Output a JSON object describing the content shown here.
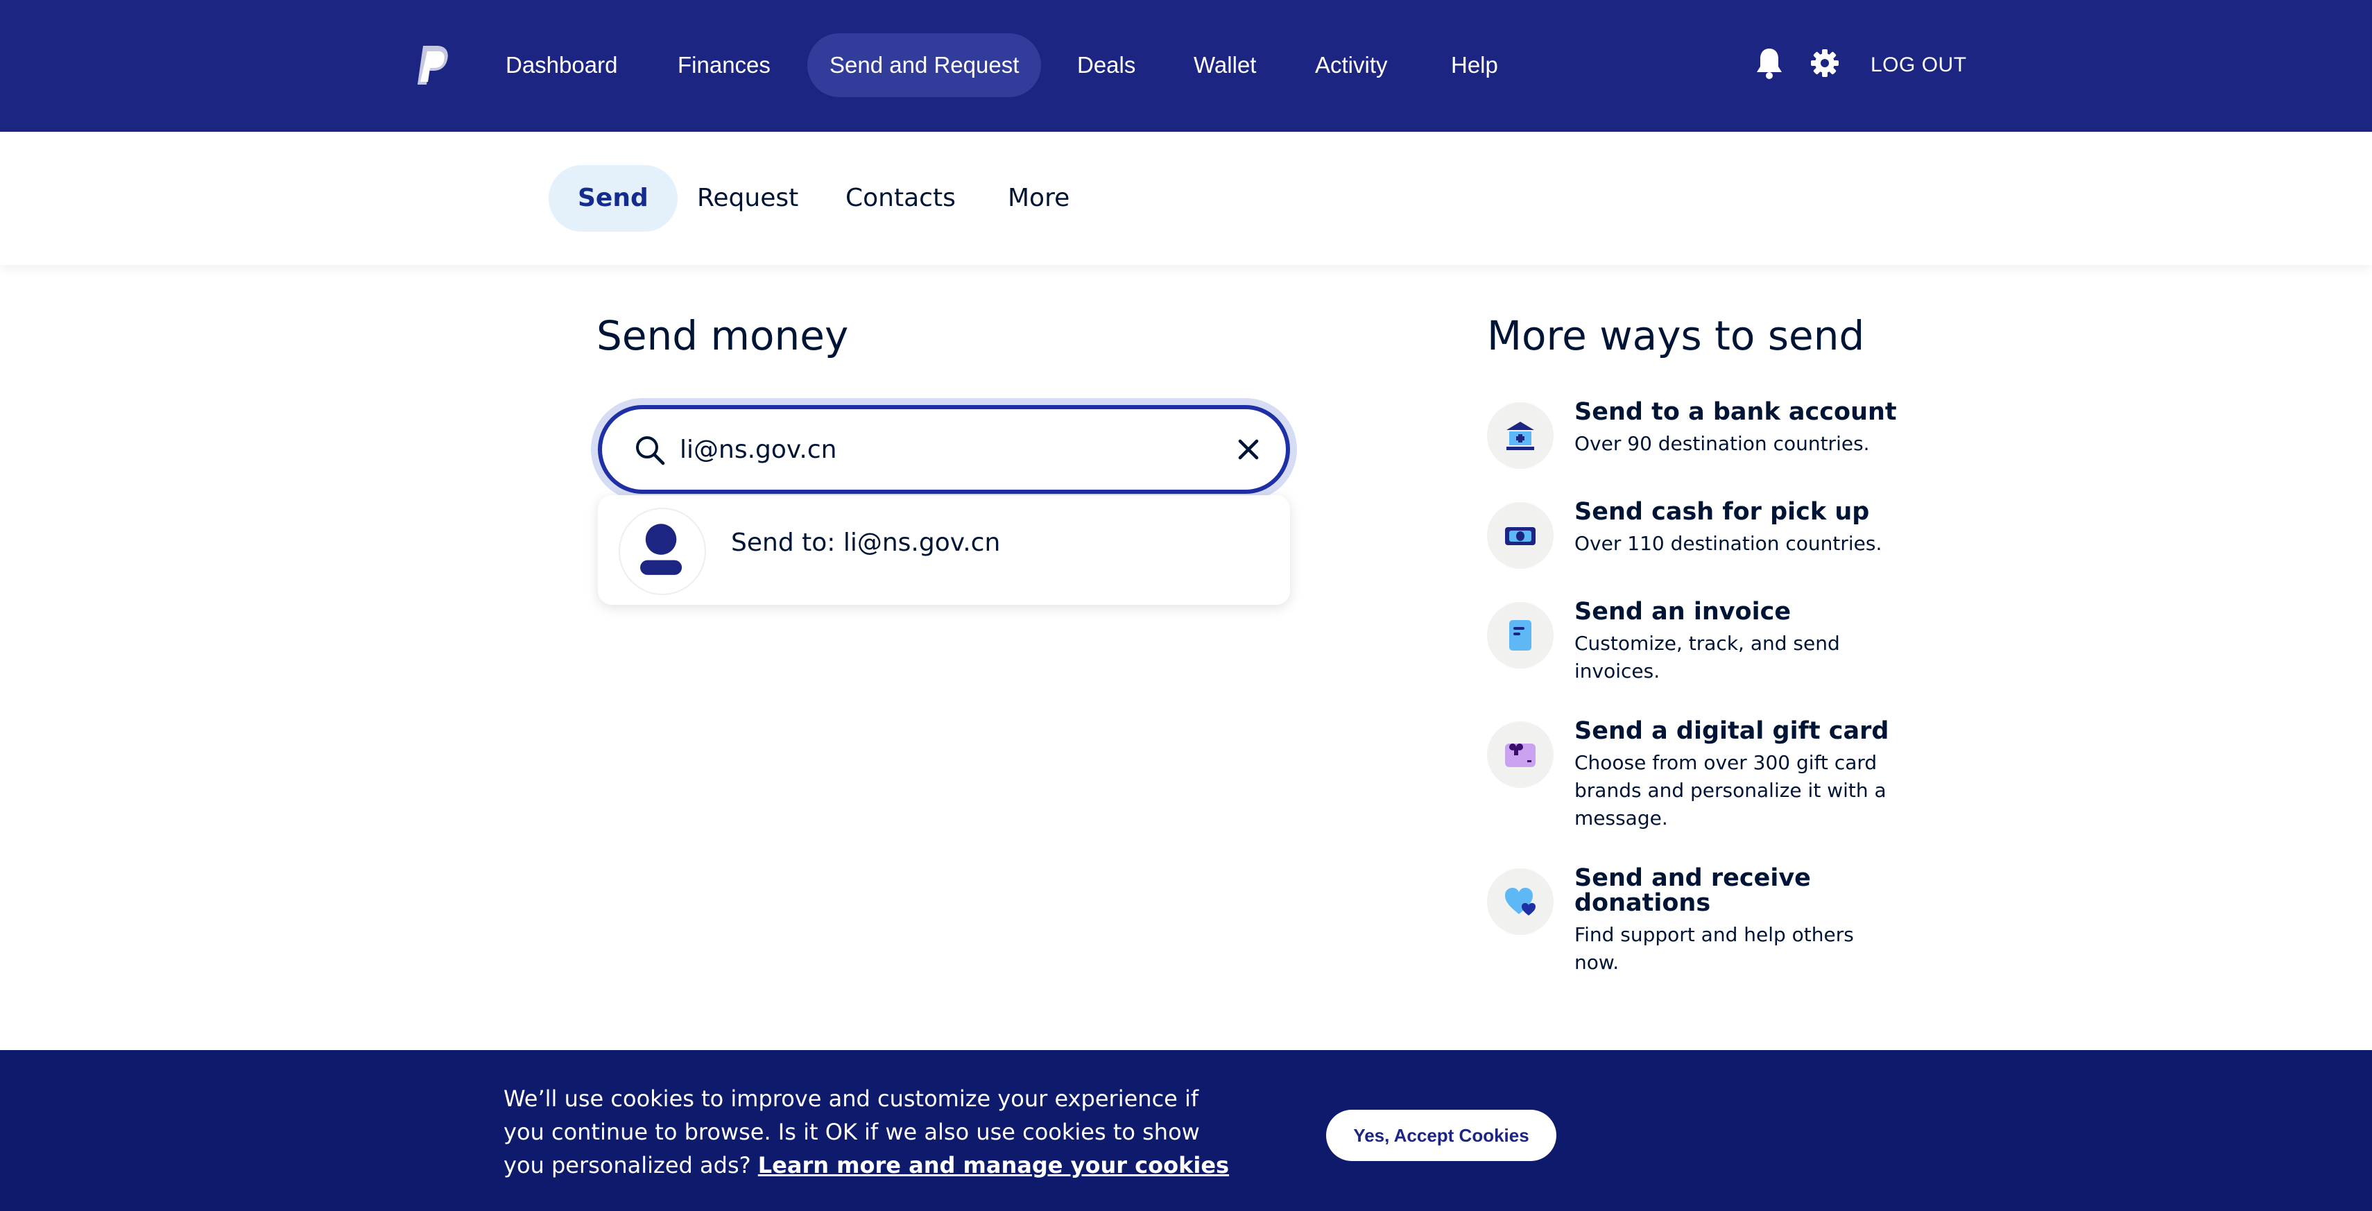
{
  "nav": {
    "items": [
      {
        "label": "Dashboard"
      },
      {
        "label": "Finances"
      },
      {
        "label": "Send and Request",
        "active": true
      },
      {
        "label": "Deals"
      },
      {
        "label": "Wallet"
      },
      {
        "label": "Activity"
      },
      {
        "label": "Help"
      }
    ],
    "logout_label": "LOG OUT",
    "icons": [
      "bell-icon",
      "gear-icon"
    ]
  },
  "subnav": {
    "tabs": [
      {
        "label": "Send",
        "active": true
      },
      {
        "label": "Request"
      },
      {
        "label": "Contacts"
      },
      {
        "label": "More"
      }
    ]
  },
  "send": {
    "title": "Send money",
    "search_value": "li@ns.gov.cn",
    "suggestion_label": "Send to: li@ns.gov.cn"
  },
  "more_ways": {
    "title": "More ways to send",
    "items": [
      {
        "title": "Send to a bank account",
        "description": "Over 90 destination countries.",
        "icon": "bank-icon"
      },
      {
        "title": "Send cash for pick up",
        "description": "Over 110 destination countries.",
        "icon": "cash-icon"
      },
      {
        "title": "Send an invoice",
        "description": "Customize, track, and send invoices.",
        "icon": "invoice-icon"
      },
      {
        "title": "Send a digital gift card",
        "description": "Choose from over 300 gift card brands and personalize it with a message.",
        "icon": "gift-card-icon"
      },
      {
        "title": "Send and receive donations",
        "description": "Find support and help others now.",
        "icon": "donation-heart-icon"
      }
    ]
  },
  "cookie_banner": {
    "text": "We’ll use cookies to improve and customize your experience if you continue to browse. Is it OK if we also use cookies to show you personalized ads? ",
    "link_label": "Learn more and manage your cookies",
    "accept_label": "Yes, Accept Cookies"
  },
  "colors": {
    "brand_navy": "#1c2682",
    "active_pill": "#323c9a",
    "search_border": "#1f2fa6",
    "cookie_bg": "#0e1a6b"
  }
}
